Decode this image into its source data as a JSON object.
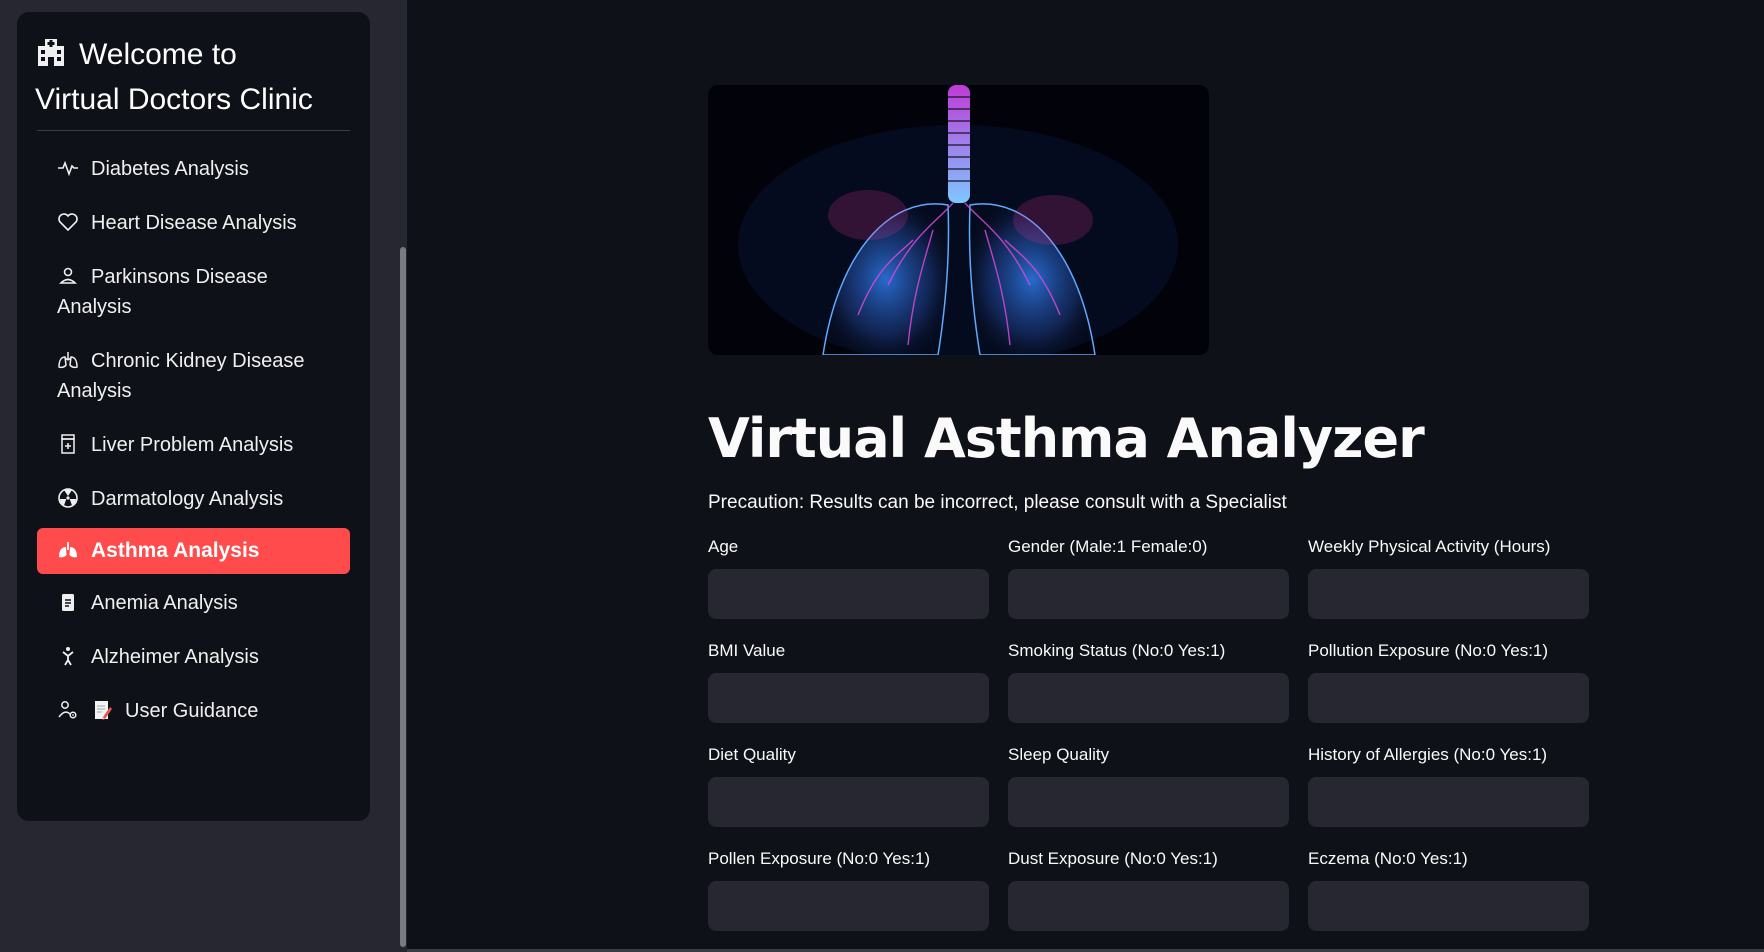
{
  "brand": {
    "icon": "hospital-icon",
    "line1": "Welcome to",
    "line2": "Virtual Doctors Clinic"
  },
  "menu": [
    {
      "label": "Diabetes Analysis",
      "icon": "activity-icon"
    },
    {
      "label": "Heart Disease Analysis",
      "icon": "heart-icon"
    },
    {
      "label": "Parkinsons Disease Analysis",
      "icon": "person-icon"
    },
    {
      "label": "Chronic Kidney Disease Analysis",
      "icon": "lungs-icon"
    },
    {
      "label": "Liver Problem Analysis",
      "icon": "prescription-icon"
    },
    {
      "label": "Darmatology Analysis",
      "icon": "radioactive-icon"
    },
    {
      "label": "Asthma Analysis",
      "icon": "lungs-filled-icon",
      "active": true
    },
    {
      "label": "Anemia Analysis",
      "icon": "clipboard-icon"
    },
    {
      "label": "Alzheimer Analysis",
      "icon": "figure-icon"
    },
    {
      "label": "User Guidance",
      "icon": "person-gear-icon",
      "emoji": "memo-icon"
    }
  ],
  "main": {
    "title": "Virtual Asthma Analyzer",
    "precaution": "Precaution: Results can be incorrect, please consult with a Specialist",
    "fields": [
      {
        "label": "Age",
        "value": ""
      },
      {
        "label": "Gender (Male:1 Female:0)",
        "value": ""
      },
      {
        "label": "Weekly Physical Activity (Hours)",
        "value": ""
      },
      {
        "label": "BMI Value",
        "value": ""
      },
      {
        "label": "Smoking Status (No:0 Yes:1)",
        "value": ""
      },
      {
        "label": "Pollution Exposure (No:0 Yes:1)",
        "value": ""
      },
      {
        "label": "Diet Quality",
        "value": ""
      },
      {
        "label": "Sleep Quality",
        "value": ""
      },
      {
        "label": "History of Allergies (No:0 Yes:1)",
        "value": ""
      },
      {
        "label": "Pollen Exposure (No:0 Yes:1)",
        "value": ""
      },
      {
        "label": "Dust Exposure (No:0 Yes:1)",
        "value": ""
      },
      {
        "label": "Eczema (No:0 Yes:1)",
        "value": ""
      }
    ]
  },
  "colors": {
    "accent": "#ff4b4b",
    "background": "#0e1117",
    "sidebar": "#262730",
    "input": "#262730"
  }
}
